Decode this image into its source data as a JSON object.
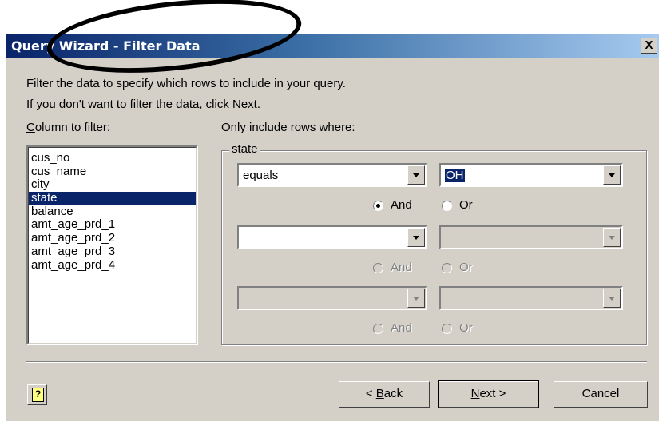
{
  "window": {
    "title": "Query Wizard - Filter Data",
    "close_label": "X"
  },
  "instructions": {
    "line1": "Filter the data to specify which rows to include in your query.",
    "line2": "If you don't want to filter the data, click Next."
  },
  "column_label": {
    "accel": "C",
    "rest": "olumn to filter:"
  },
  "columns": [
    "cus_no",
    "cus_name",
    "city",
    "state",
    "balance",
    "amt_age_prd_1",
    "amt_age_prd_2",
    "amt_age_prd_3",
    "amt_age_prd_4"
  ],
  "selected_column": "state",
  "rows_label": "Only include rows where:",
  "group_title": "state",
  "conditions": [
    {
      "operator": "equals",
      "value": "OH",
      "and_label": "And",
      "or_label": "Or",
      "and_selected": true
    },
    {
      "operator": "",
      "value": "",
      "and_label": "And",
      "or_label": "Or"
    },
    {
      "operator": "",
      "value": "",
      "and_label": "And",
      "or_label": "Or"
    }
  ],
  "buttons": {
    "help_icon": "?",
    "back": {
      "prefix": "< ",
      "accel": "B",
      "rest": "ack"
    },
    "next": {
      "accel": "N",
      "rest": "ext >"
    },
    "cancel": "Cancel"
  },
  "colors": {
    "titlebar": "#0a246a",
    "selection": "#0a246a",
    "dialog_face": "#d4d0c8"
  }
}
